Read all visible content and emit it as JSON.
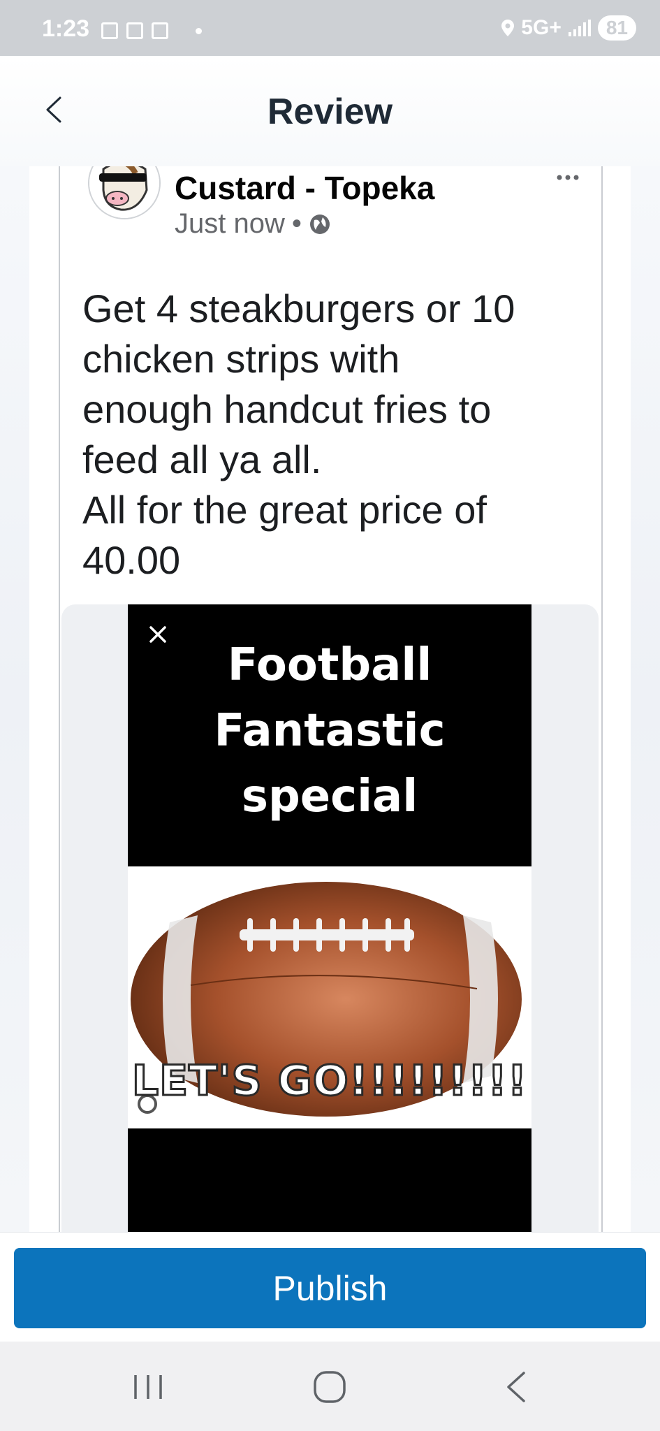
{
  "status_bar": {
    "time": "1:23",
    "network": "5G+",
    "battery": "81"
  },
  "header": {
    "title": "Review",
    "back_icon": "chevron-left-icon"
  },
  "post": {
    "page_name": "Custard - Topeka",
    "timestamp": "Just now",
    "separator": "•",
    "privacy_icon": "globe-icon",
    "body": "Get 4 steakburgers or 10\nchicken strips with\nenough handcut fries to\nfeed all ya all.\nAll for the great price of\n40.00",
    "media": {
      "headline": "Football\nFantastic\nspecial",
      "caption": "LET'S GO!!!!!!!!!"
    }
  },
  "actions": {
    "publish_label": "Publish"
  },
  "colors": {
    "publish": "#0c74bc",
    "status_bar": "#cdd0d4",
    "football": "#a5512c"
  }
}
